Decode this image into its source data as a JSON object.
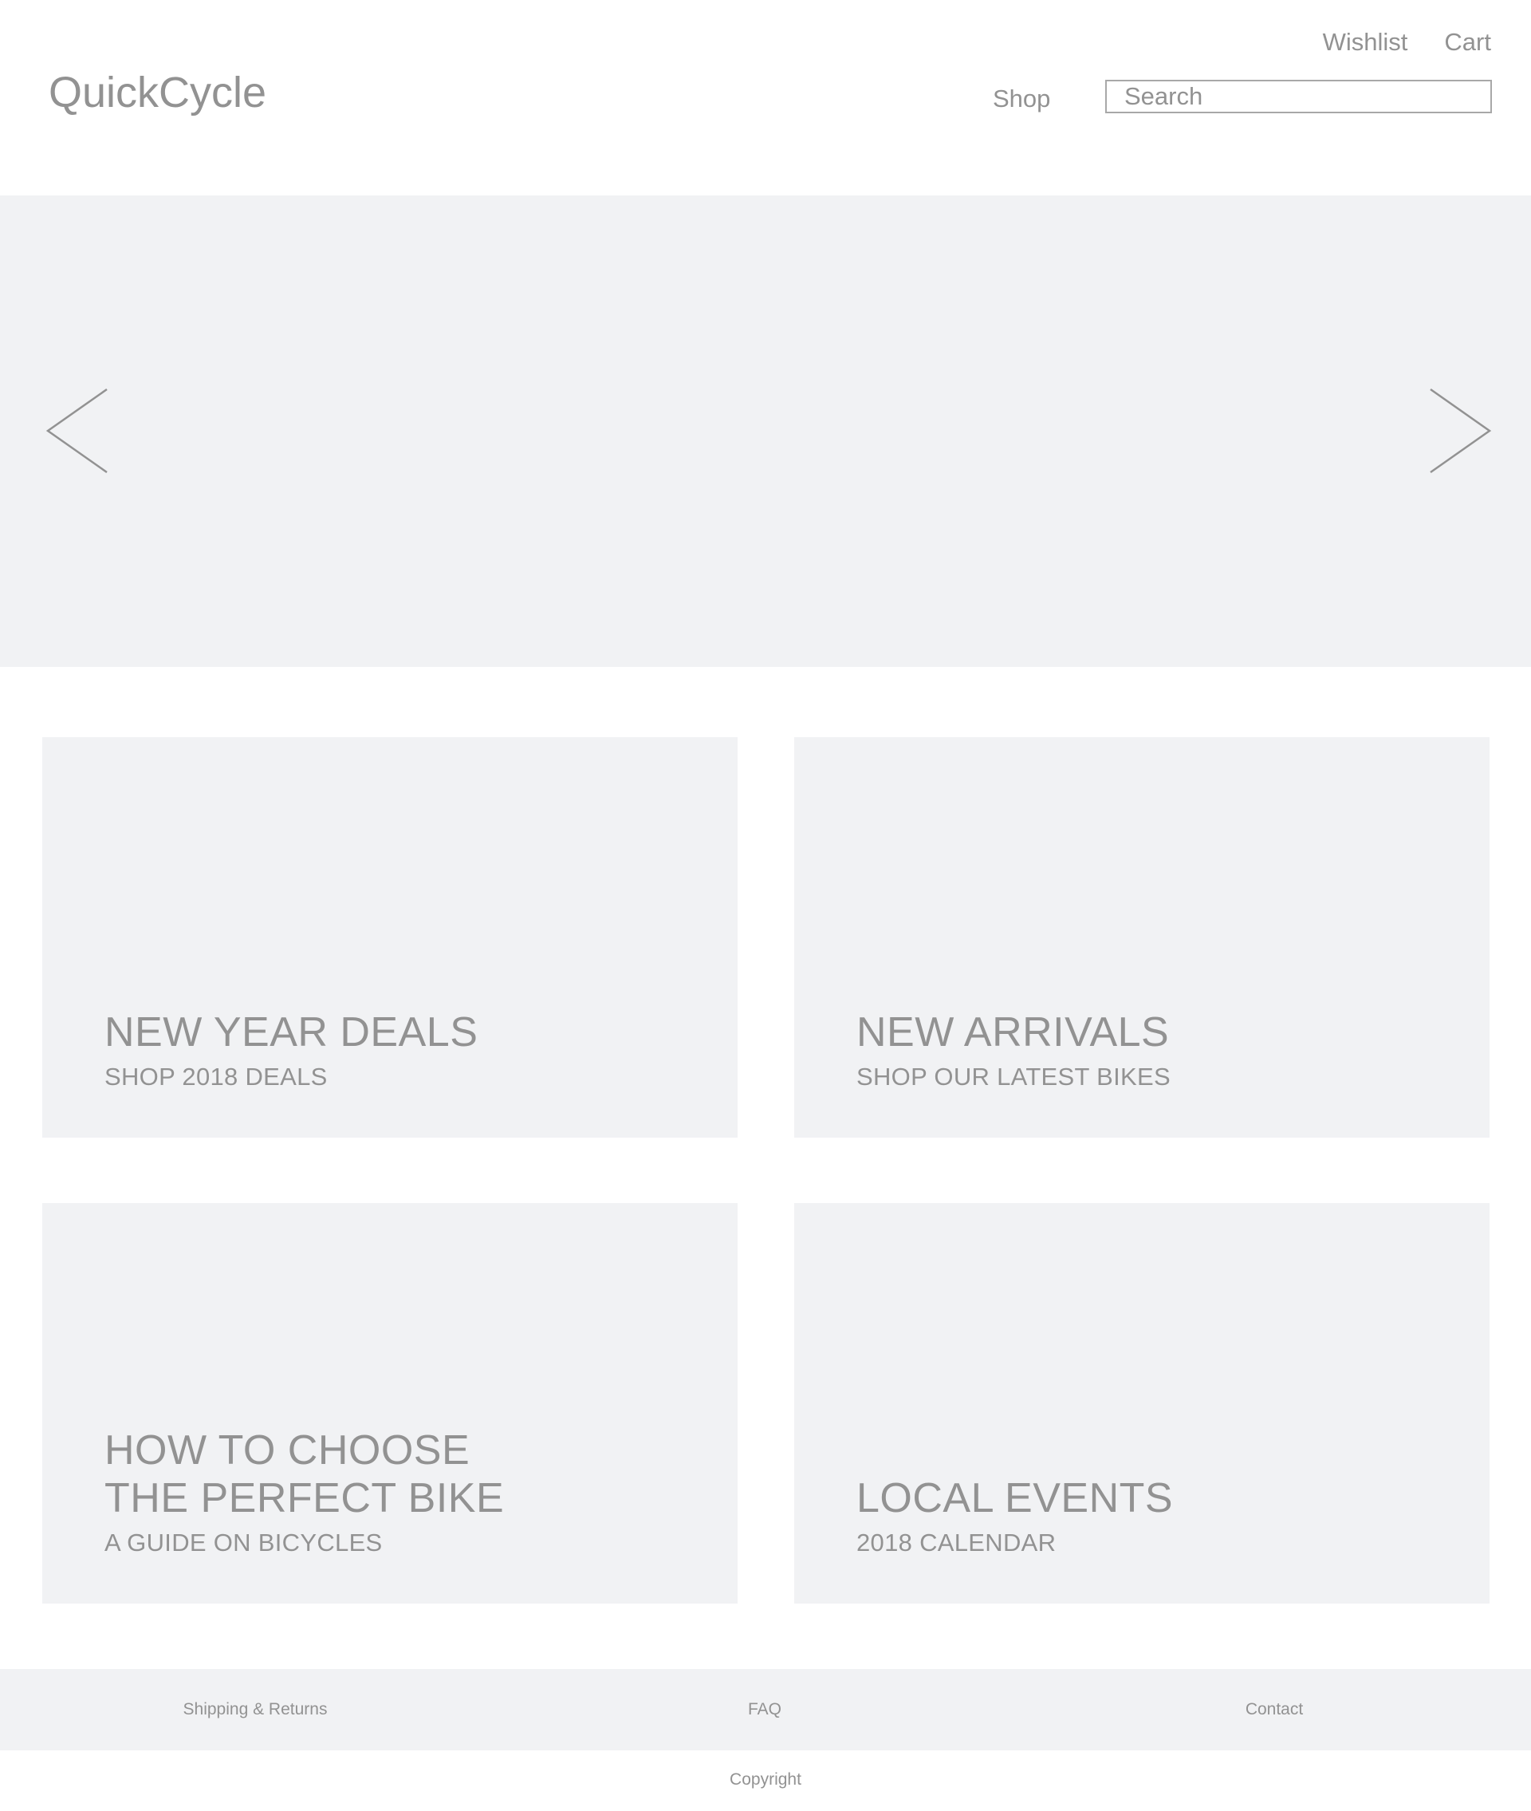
{
  "brand": {
    "logo_text": "QuickCycle"
  },
  "header": {
    "top_links": {
      "wishlist": "Wishlist",
      "cart": "Cart"
    },
    "nav": {
      "shop": "Shop"
    },
    "search": {
      "placeholder": "Search",
      "value": ""
    }
  },
  "hero": {
    "prev_icon": "chevron-left-icon",
    "next_icon": "chevron-right-icon"
  },
  "cards": [
    {
      "title_line1": "NEW YEAR DEALS",
      "title_line2": "",
      "subtitle": "SHOP 2018 DEALS"
    },
    {
      "title_line1": "NEW ARRIVALS",
      "title_line2": "",
      "subtitle": "SHOP OUR LATEST BIKES"
    },
    {
      "title_line1": "HOW TO CHOOSE",
      "title_line2": "THE PERFECT BIKE",
      "subtitle": "A GUIDE ON BICYCLES"
    },
    {
      "title_line1": "LOCAL EVENTS",
      "title_line2": "",
      "subtitle": "2018 CALENDAR"
    }
  ],
  "footer": {
    "links": [
      "Shipping & Returns",
      "FAQ",
      "Contact"
    ],
    "copyright": "Copyright"
  },
  "colors": {
    "text": "#929292",
    "panel_bg": "#f1f2f4",
    "page_bg": "#ffffff",
    "input_border": "#a8a8a8"
  }
}
